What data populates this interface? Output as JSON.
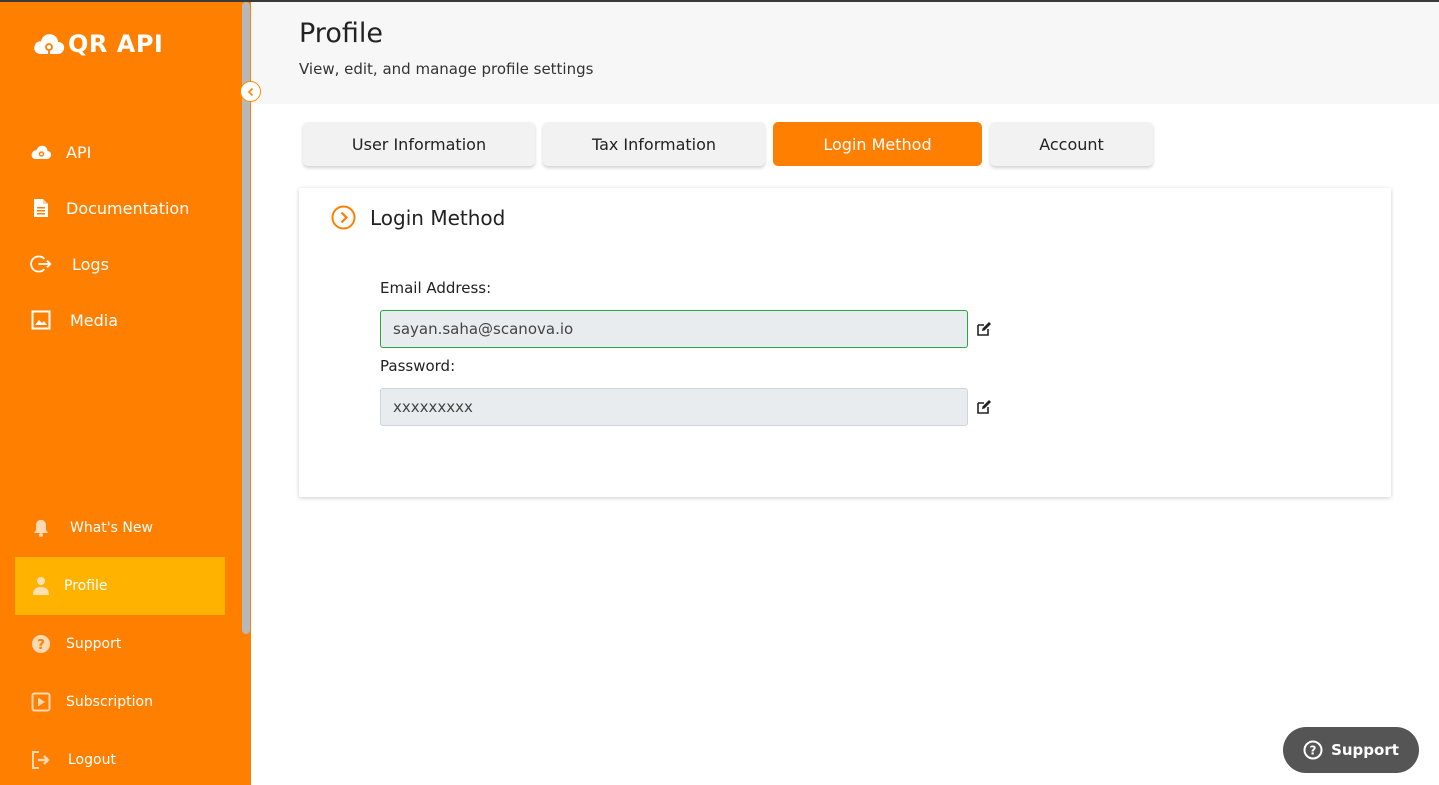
{
  "brand": {
    "name": "QR API",
    "accent": "#ff7f00",
    "active": "#ffb300"
  },
  "sidebar": {
    "top_items": [
      {
        "label": "API",
        "icon": "cloud-icon"
      },
      {
        "label": "Documentation",
        "icon": "document-icon"
      },
      {
        "label": "Logs",
        "icon": "sign-out-icon"
      },
      {
        "label": "Media",
        "icon": "image-icon"
      }
    ],
    "bottom_items": [
      {
        "label": "What's New",
        "icon": "bell-icon"
      },
      {
        "label": "Profile",
        "icon": "user-icon",
        "active": true
      },
      {
        "label": "Support",
        "icon": "question-circle-icon"
      },
      {
        "label": "Subscription",
        "icon": "play-square-icon"
      },
      {
        "label": "Logout",
        "icon": "logout-icon"
      }
    ]
  },
  "header": {
    "title": "Profile",
    "subtitle": "View, edit, and manage profile settings"
  },
  "tabs": [
    {
      "label": "User Information"
    },
    {
      "label": "Tax Information"
    },
    {
      "label": "Login Method",
      "active": true
    },
    {
      "label": "Account"
    }
  ],
  "card": {
    "title": "Login Method",
    "email_label": "Email Address:",
    "email_value": "sayan.saha@scanova.io",
    "password_label": "Password:",
    "password_value": "xxxxxxxxx"
  },
  "support_fab": {
    "label": "Support"
  }
}
